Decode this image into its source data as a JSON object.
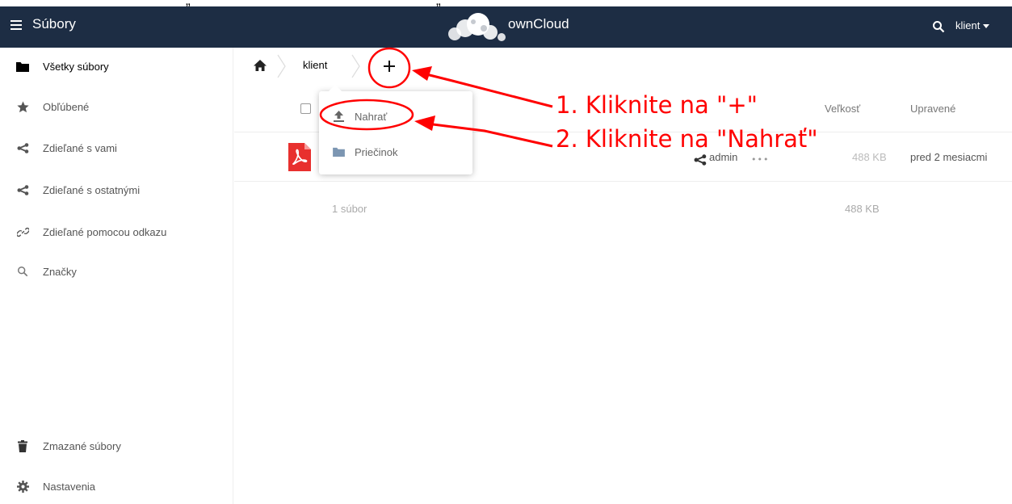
{
  "top_fragment": {
    "left_text": "„",
    "right_text": "„"
  },
  "header": {
    "app_title": "Súbory",
    "brand": "ownCloud",
    "user": "klient",
    "menu_icon": "hamburger-icon",
    "search_icon": "search-icon",
    "logo_icon": "cloud-logo-icon"
  },
  "sidebar": {
    "items": [
      {
        "label": "Všetky súbory",
        "icon": "folder-icon"
      },
      {
        "label": "Obľúbené",
        "icon": "star-icon"
      },
      {
        "label": "Zdieľané s vami",
        "icon": "share-icon"
      },
      {
        "label": "Zdieľané s ostatnými",
        "icon": "share-icon"
      },
      {
        "label": "Zdieľané pomocou odkazu",
        "icon": "link-icon"
      },
      {
        "label": "Značky",
        "icon": "tag-search-icon"
      }
    ],
    "bottom": [
      {
        "label": "Zmazané súbory",
        "icon": "trash-icon"
      },
      {
        "label": "Nastavenia",
        "icon": "gear-icon"
      }
    ]
  },
  "breadcrumb": {
    "current": "klient",
    "add_label": "+"
  },
  "dropdown": {
    "upload": "Nahrať",
    "folder": "Priečinok"
  },
  "table": {
    "columns": {
      "size": "Veľkosť",
      "modified": "Upravené"
    },
    "rows": [
      {
        "type": "pdf",
        "owner": "admin",
        "size": "488 KB",
        "modified": "pred 2 mesiacmi"
      }
    ],
    "summary": {
      "count": "1 súbor",
      "total": "488 KB"
    }
  },
  "annotations": {
    "step1": "1. Kliknite na \"+\"",
    "step2": "2. Kliknite na \"Nahrať\"",
    "color": "#ff0000"
  },
  "colors": {
    "header_bg": "#1d2d44",
    "pdf_red": "#e8302e"
  }
}
